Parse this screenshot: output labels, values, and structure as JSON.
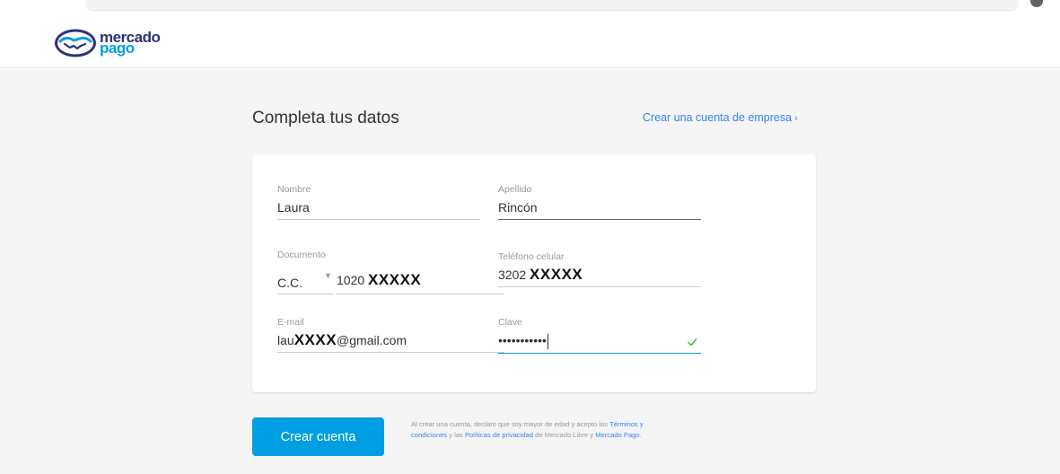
{
  "brand": {
    "logo_line1": "mercado",
    "logo_line2": "pago",
    "primary_color": "#009ee3",
    "dark_color": "#2d3277",
    "link_color": "#3483fa"
  },
  "form": {
    "title": "Completa tus datos",
    "business_link": "Crear una cuenta de empresa",
    "business_link_icon": "chevron-right-icon",
    "first_name": {
      "label": "Nombre",
      "value": "Laura"
    },
    "last_name": {
      "label": "Apellido",
      "value": "Rincón"
    },
    "document": {
      "label": "Documento",
      "type": "C.C.",
      "number_prefix": "1020",
      "number_redacted": "XXXXX"
    },
    "phone": {
      "label": "Teléfono celular",
      "prefix": "3202",
      "redacted": "XXXXX"
    },
    "email": {
      "label": "E-mail",
      "prefix": "lau",
      "redacted": "XXXX",
      "suffix": "@gmail.com"
    },
    "password": {
      "label": "Clave",
      "masked_value": "•••••••••••",
      "status_icon": "check-icon"
    }
  },
  "submit_label": "Crear cuenta",
  "legal": {
    "text1": "Al crear una cuenta, declaro que soy mayor de edad y acepto los",
    "terms_link": "Términos y condiciones",
    "text2": "y las",
    "privacy_link": "Políticas de privacidad",
    "text3": "de Mercado Libre y",
    "mp_link": "Mercado Pago",
    "text4": "."
  }
}
